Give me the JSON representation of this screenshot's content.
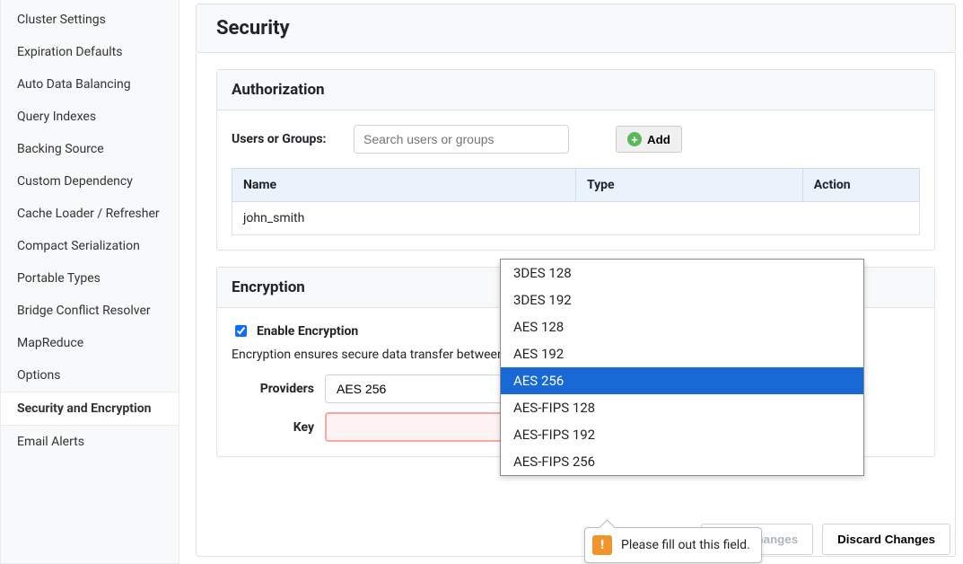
{
  "sidebar": {
    "items": [
      {
        "label": "Cluster Settings",
        "active": false
      },
      {
        "label": "Expiration Defaults",
        "active": false
      },
      {
        "label": "Auto Data Balancing",
        "active": false
      },
      {
        "label": "Query Indexes",
        "active": false
      },
      {
        "label": "Backing Source",
        "active": false
      },
      {
        "label": "Custom Dependency",
        "active": false
      },
      {
        "label": "Cache Loader / Refresher",
        "active": false
      },
      {
        "label": "Compact Serialization",
        "active": false
      },
      {
        "label": "Portable Types",
        "active": false
      },
      {
        "label": "Bridge Conflict Resolver",
        "active": false
      },
      {
        "label": "MapReduce",
        "active": false
      },
      {
        "label": "Options",
        "active": false
      },
      {
        "label": "Security and Encryption",
        "active": true
      },
      {
        "label": "Email Alerts",
        "active": false
      }
    ]
  },
  "page": {
    "title": "Security"
  },
  "authorization": {
    "header": "Authorization",
    "usersLabel": "Users or Groups:",
    "searchPlaceholder": "Search users or groups",
    "addLabel": "Add",
    "columns": {
      "name": "Name",
      "type": "Type",
      "action": "Action"
    },
    "rows": [
      {
        "name": "john_smith"
      }
    ]
  },
  "encryption": {
    "header": "Encryption",
    "enableLabel": "Enable Encryption",
    "description": "Encryption ensures secure data transfer between client-server as well as cache servers as well.",
    "providersLabel": "Providers",
    "providerSelected": "AES 256",
    "keyLabel": "Key",
    "keyValue": "",
    "providerOptions": [
      "3DES 128",
      "3DES 192",
      "AES 128",
      "AES 192",
      "AES 256",
      "AES-FIPS 128",
      "AES-FIPS 192",
      "AES-FIPS 256"
    ]
  },
  "tooltip": {
    "text": "Please fill out this field."
  },
  "footer": {
    "save": "Save Changes",
    "discard": "Discard Changes"
  }
}
